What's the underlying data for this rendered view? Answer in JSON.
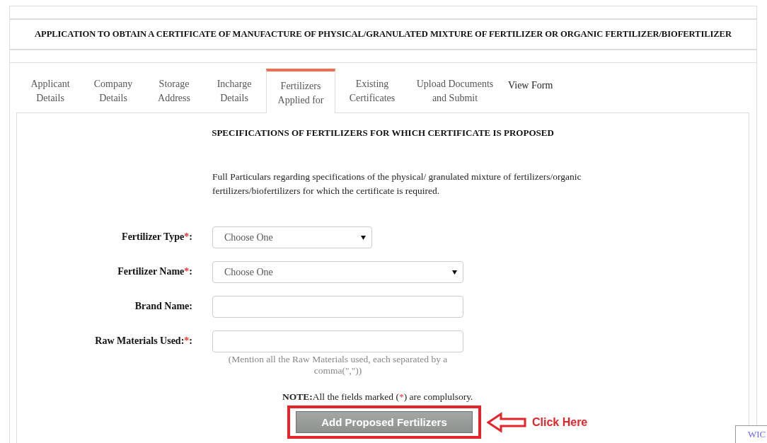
{
  "title": "APPLICATION TO OBTAIN A CERTIFICATE OF MANUFACTURE OF PHYSICAL/GRANULATED MIXTURE OF FERTILIZER OR ORGANIC FERTILIZER/BIOFERTILIZER",
  "tabs": [
    {
      "label": "Applicant Details",
      "selected": false
    },
    {
      "label": "Company Details",
      "selected": false
    },
    {
      "label": "Storage Address",
      "selected": false
    },
    {
      "label": "Incharge Details",
      "selected": false
    },
    {
      "label": "Fertilizers Applied for",
      "selected": true
    },
    {
      "label": "Existing Certificates",
      "selected": false
    },
    {
      "label": "Upload Documents and Submit",
      "selected": false
    },
    {
      "label": "View Form",
      "selected": false
    }
  ],
  "section_title": "SPECIFICATIONS OF FERTILIZERS FOR WHICH CERTIFICATE IS PROPOSED",
  "intro": "Full Particulars regarding specifications of the physical/ granulated mixture of fertilizers/organic fertilizers/biofertilizers for which the certificate is required.",
  "fields": [
    {
      "kind": "select",
      "label": "Fertilizer Type",
      "mark": "*",
      "end": ":",
      "value": "Choose One",
      "wide": false
    },
    {
      "kind": "select",
      "label": "Fertilizer Name",
      "mark": "*",
      "end": ":",
      "value": "Choose One",
      "wide": true
    },
    {
      "kind": "text",
      "label": "Brand Name",
      "end": ":",
      "wide": true
    },
    {
      "kind": "text",
      "label": "Raw Materials Used:",
      "mark": "*",
      "end": ":",
      "wide": true,
      "hint": "(Mention all the Raw Materials used, each separated by a comma(\",\"))"
    }
  ],
  "note": {
    "label": "NOTE:",
    "before": "All the fields marked (",
    "mark": "*",
    "after": ") are complulsory."
  },
  "button": "Add Proposed Fertilizers",
  "callout": "Click Here",
  "corner_tab": "WIC"
}
